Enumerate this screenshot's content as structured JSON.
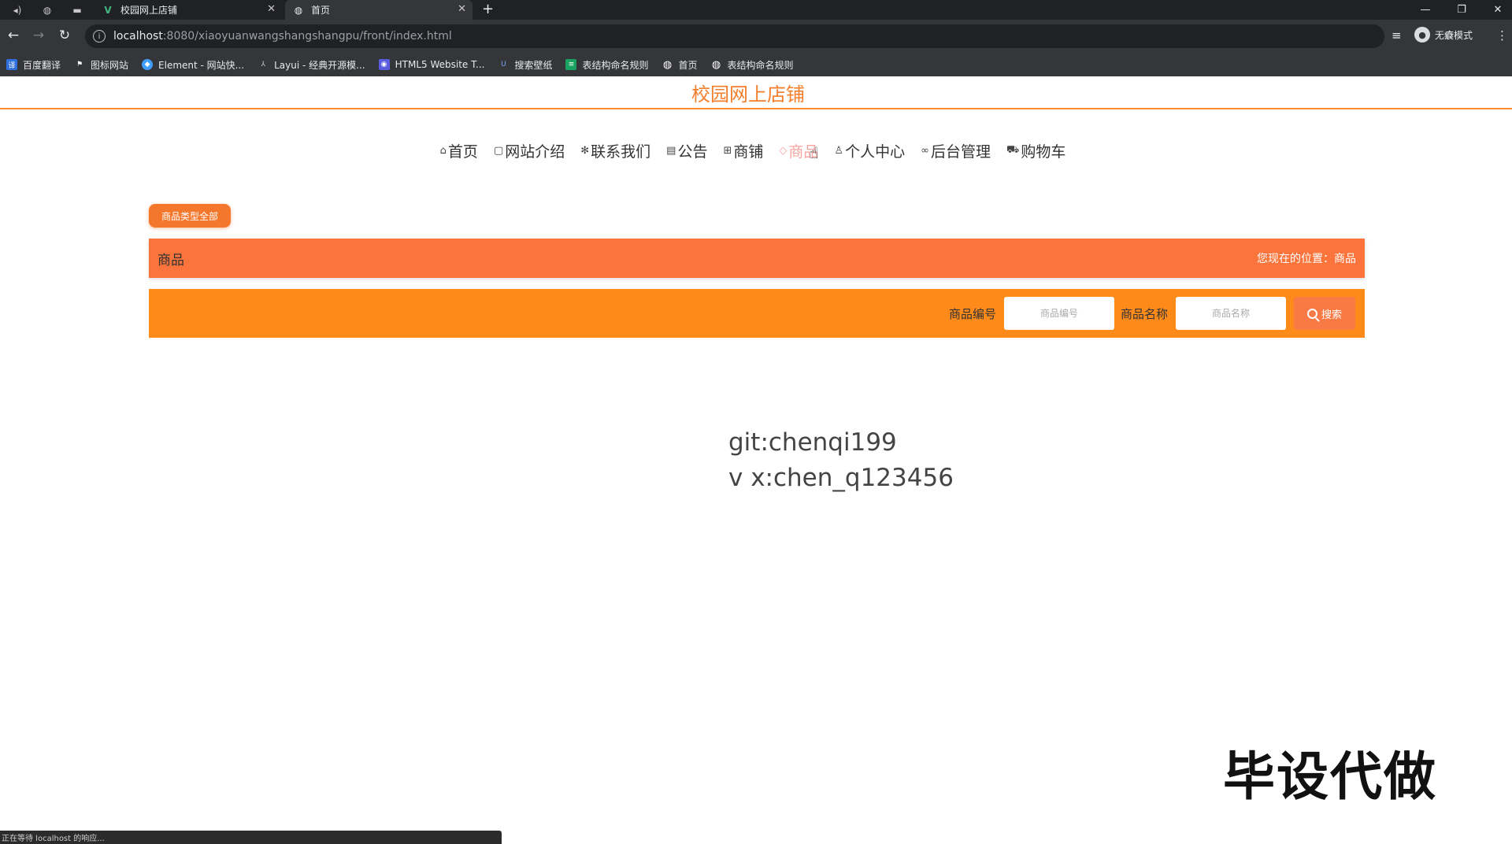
{
  "browser": {
    "tabs": [
      {
        "title": "校园网上店铺",
        "icon": "vue-icon"
      },
      {
        "title": "首页",
        "icon": "globe-icon"
      }
    ],
    "url_host": "localhost",
    "url_path": ":8080/xiaoyuanwangshangshangpu/front/index.html",
    "profile_label": "无痕模式",
    "bookmarks": [
      {
        "label": "百度翻译",
        "color": "#2f6fde"
      },
      {
        "label": "图标网站",
        "color": "#ffffff"
      },
      {
        "label": "Element - 网站快...",
        "color": "#409eff"
      },
      {
        "label": "Layui - 经典开源模...",
        "color": "#888888"
      },
      {
        "label": "HTML5 Website T...",
        "color": "#5b5be0"
      },
      {
        "label": "搜索壁纸",
        "color": "#4a7bd6"
      },
      {
        "label": "表结构命名规则",
        "color": "#1aa260"
      },
      {
        "label": "首页",
        "color": "#e8eaed"
      },
      {
        "label": "表结构命名规则",
        "color": "#e8eaed"
      }
    ],
    "status_text": "正在等待 localhost 的响应..."
  },
  "site": {
    "title": "校园网上店铺",
    "accent": "#f47d2a",
    "nav": [
      {
        "label": "首页",
        "icon": "home-icon"
      },
      {
        "label": "网站介绍",
        "icon": "bookmark-icon"
      },
      {
        "label": "联系我们",
        "icon": "gear-icon"
      },
      {
        "label": "公告",
        "icon": "notice-icon"
      },
      {
        "label": "商铺",
        "icon": "grid-icon"
      },
      {
        "label": "商品",
        "icon": "tag-icon",
        "active": true
      },
      {
        "label": "个人中心",
        "icon": "user-icon"
      },
      {
        "label": "后台管理",
        "icon": "link-icon"
      },
      {
        "label": "购物车",
        "icon": "cart-icon"
      }
    ]
  },
  "main": {
    "type_filter_label": "商品类型全部",
    "section_title": "商品",
    "location_label": "您现在的位置：商品",
    "search": {
      "code_label": "商品编号",
      "code_placeholder": "商品编号",
      "name_label": "商品名称",
      "name_placeholder": "商品名称",
      "button_label": "搜索"
    }
  },
  "overlay": {
    "line1": "git:chenqi199",
    "line2": "v x:chen_q123456",
    "watermark": "毕设代做"
  }
}
